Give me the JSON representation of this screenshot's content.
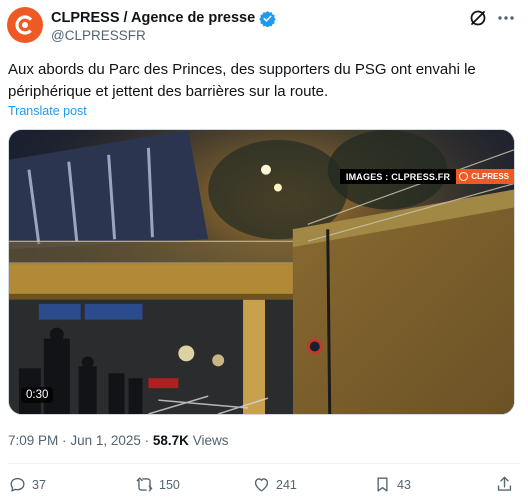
{
  "post": {
    "author_name": "CLPRESS / Agence de presse",
    "author_handle": "@CLPRESSFR",
    "verified": true,
    "text_line1": "Aux abords du Parc des Princes, des supporters du PSG ont envahi le",
    "text_line2": "périphérique et jettent des barrières sur la route.",
    "translate_label": "Translate post",
    "time": "7:09 PM",
    "separator": "·",
    "date": "Jun 1, 2025",
    "views_count": "58.7K",
    "views_label": "Views"
  },
  "media": {
    "watermark_text": "IMAGES : CLPRESS.FR",
    "watermark_brand": "CLPRESS",
    "duration": "0:30"
  },
  "actions": {
    "replies": "37",
    "reposts": "150",
    "likes": "241",
    "bookmarks": "43"
  },
  "colors": {
    "brand_orange": "#ef5a24",
    "link_blue": "#1d9bf0",
    "muted_gray": "#536471",
    "text_dark": "#0f1419"
  },
  "icons": [
    "avatar-logo-icon",
    "verified-badge-icon",
    "grok-icon",
    "more-icon",
    "reply-icon",
    "repost-icon",
    "like-icon",
    "bookmark-icon",
    "share-icon"
  ]
}
